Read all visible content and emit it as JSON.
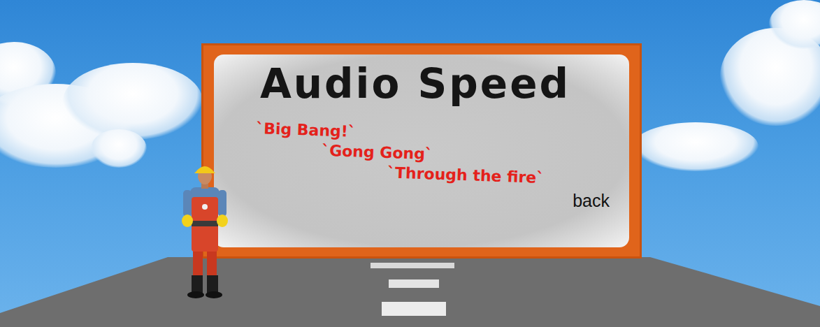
{
  "billboard": {
    "title": "Audio Speed",
    "songs": [
      "`Big Bang!`",
      "`Gong Gong`",
      "`Through the fire`"
    ],
    "back": "back"
  }
}
